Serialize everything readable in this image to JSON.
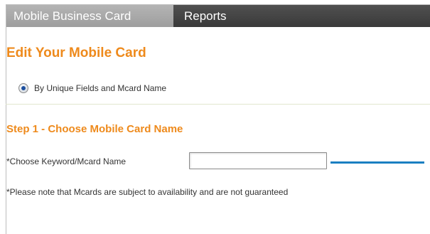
{
  "tabs": [
    {
      "label": "Mobile Business Card",
      "active": true
    },
    {
      "label": "Reports",
      "active": false
    }
  ],
  "page_title": "Edit Your Mobile Card",
  "radio_option": {
    "label": "By Unique Fields and Mcard Name",
    "selected": true
  },
  "step": {
    "title": "Step 1 - Choose Mobile Card Name"
  },
  "keyword_field": {
    "label": "*Choose Keyword/Mcard Name",
    "value": "",
    "placeholder": ""
  },
  "note": "*Please note that Mcards are subject to availability and are not guaranteed",
  "colors": {
    "accent_orange": "#ee8a1c",
    "tab_bar": "#3a3a3a",
    "active_tab": "#9e9e9e",
    "highlight_line": "#1a7fc1"
  }
}
